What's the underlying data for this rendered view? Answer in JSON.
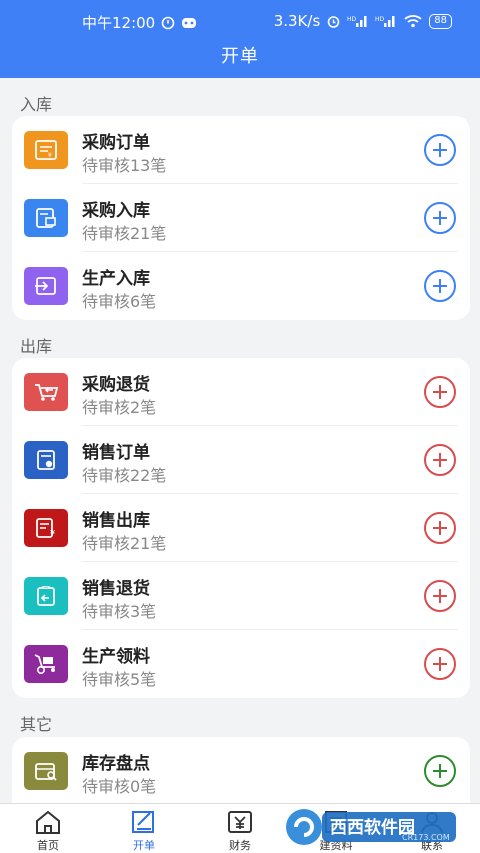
{
  "status_bar": {
    "time": "中午12:00",
    "net_speed": "3.3K/s",
    "battery": "88"
  },
  "header": {
    "title": "开单"
  },
  "colors": {
    "primary": "#3f80f6",
    "blue_add": "#3f80f6",
    "red_add": "#d94c4c",
    "green_add": "#2e8b2e"
  },
  "sections": [
    {
      "title": "入库",
      "items": [
        {
          "name": "采购订单",
          "sub": "待审核13笔",
          "icon": "purchase-order-icon",
          "icon_color": "#f0961e"
        },
        {
          "name": "采购入库",
          "sub": "待审核21笔",
          "icon": "purchase-inbound-icon",
          "icon_color": "#3a86f0"
        },
        {
          "name": "生产入库",
          "sub": "待审核6笔",
          "icon": "production-inbound-icon",
          "icon_color": "#8f63f0"
        }
      ]
    },
    {
      "title": "出库",
      "items": [
        {
          "name": "采购退货",
          "sub": "待审核2笔",
          "icon": "purchase-return-icon",
          "icon_color": "#e05252"
        },
        {
          "name": "销售订单",
          "sub": "待审核22笔",
          "icon": "sales-order-icon",
          "icon_color": "#2a62c6"
        },
        {
          "name": "销售出库",
          "sub": "待审核21笔",
          "icon": "sales-outbound-icon",
          "icon_color": "#c01818"
        },
        {
          "name": "销售退货",
          "sub": "待审核3笔",
          "icon": "sales-return-icon",
          "icon_color": "#1cbfbf"
        },
        {
          "name": "生产领料",
          "sub": "待审核5笔",
          "icon": "production-picking-icon",
          "icon_color": "#8e2a9c"
        }
      ]
    },
    {
      "title": "其它",
      "items": [
        {
          "name": "库存盘点",
          "sub": "待审核0笔",
          "icon": "stock-count-icon",
          "icon_color": "#8a8a3c"
        }
      ]
    }
  ],
  "tabbar": [
    {
      "label": "首页",
      "icon": "home-icon"
    },
    {
      "label": "开单",
      "icon": "order-form-icon"
    },
    {
      "label": "财务",
      "icon": "finance-yen-icon"
    },
    {
      "label": "建资料",
      "icon": "create-data-icon"
    },
    {
      "label": "联系",
      "icon": "contact-icon"
    }
  ],
  "watermark": {
    "text": "西西软件园",
    "url_text": "CR173.COM"
  }
}
